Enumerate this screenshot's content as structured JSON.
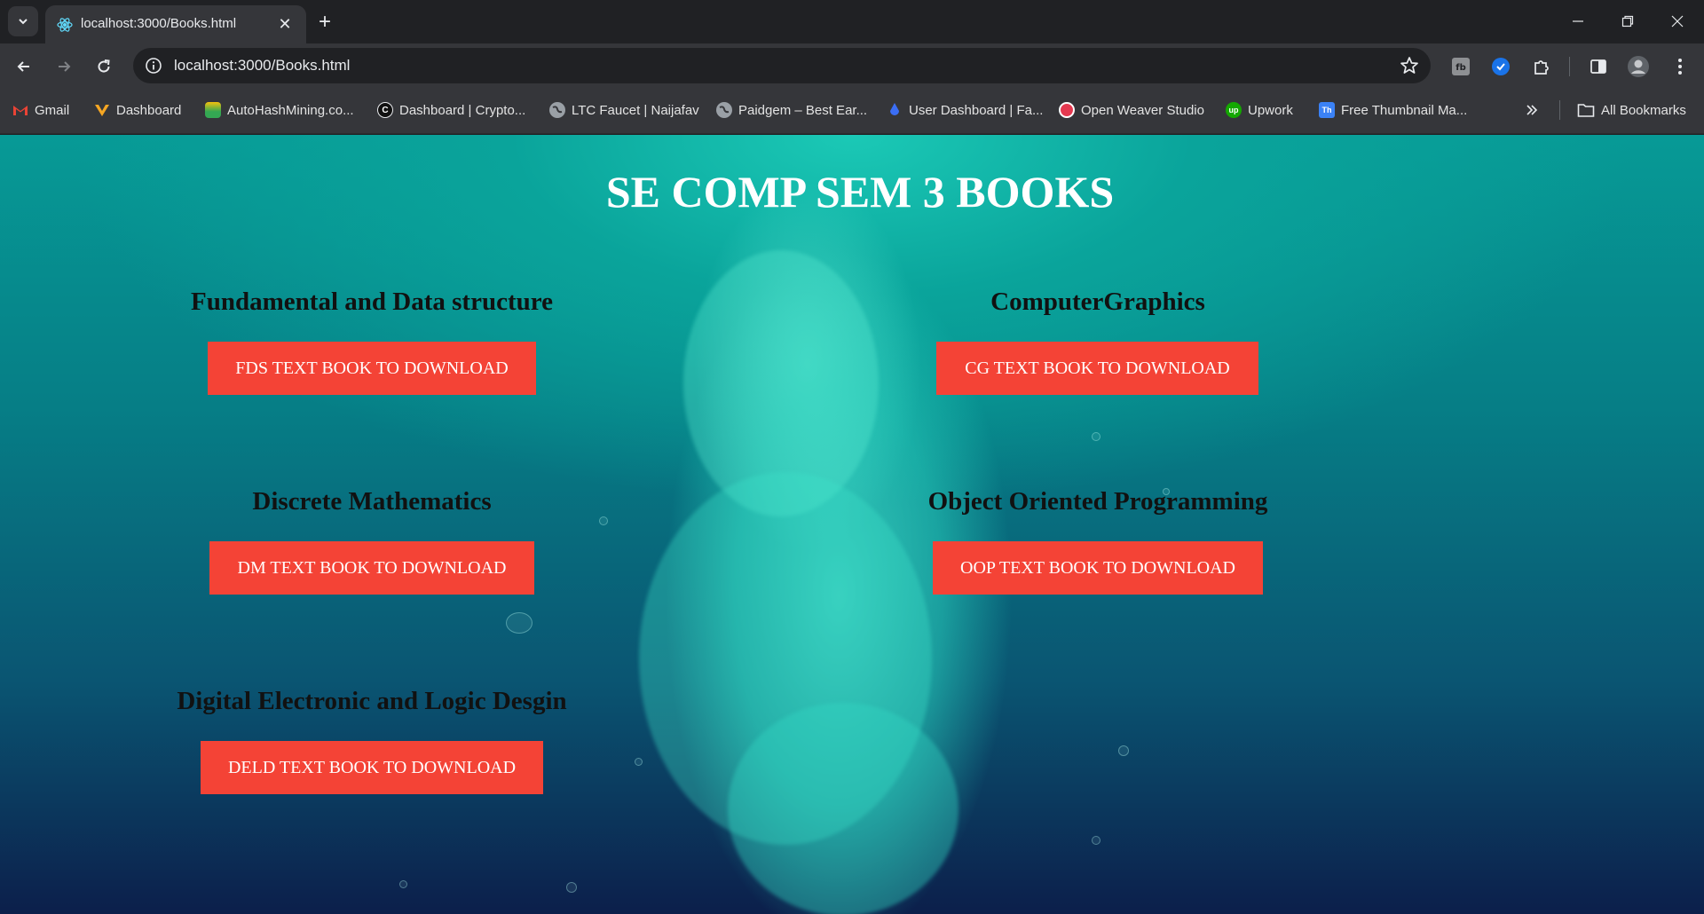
{
  "browser": {
    "tab": {
      "title": "localhost:3000/Books.html"
    },
    "url": "localhost:3000/Books.html",
    "bookmarks": [
      {
        "label": "Gmail",
        "icon": "gmail-icon",
        "color": "#ea4335"
      },
      {
        "label": "Dashboard",
        "icon": "dashboard-icon",
        "color": "#f5a623"
      },
      {
        "label": "AutoHashMining.co...",
        "icon": "autohashmining-icon",
        "color": "#34a853"
      },
      {
        "label": "Dashboard | Crypto...",
        "icon": "crypto-icon",
        "color": "#111111"
      },
      {
        "label": "LTC Faucet | Naijafav",
        "icon": "globe-icon",
        "color": "#9aa0a6"
      },
      {
        "label": "Paidgem – Best Ear...",
        "icon": "globe-icon",
        "color": "#9aa0a6"
      },
      {
        "label": "User Dashboard | Fa...",
        "icon": "drop-icon",
        "color": "#3b6ef5"
      },
      {
        "label": "Open Weaver Studio",
        "icon": "openweaver-icon",
        "color": "#e53950"
      },
      {
        "label": "Upwork",
        "icon": "upwork-icon",
        "color": "#14a800"
      },
      {
        "label": "Free Thumbnail Ma...",
        "icon": "thumbnail-icon",
        "color": "#3b82f6"
      }
    ],
    "all_bookmarks": "All Bookmarks"
  },
  "page": {
    "title": "SE COMP SEM 3 BOOKS",
    "books": [
      {
        "subject": "Fundamental and Data structure",
        "button": "FDS TEXT BOOK TO DOWNLOAD"
      },
      {
        "subject": "ComputerGraphics",
        "button": "CG TEXT BOOK TO DOWNLOAD"
      },
      {
        "subject": "Discrete Mathematics",
        "button": "DM TEXT BOOK TO DOWNLOAD"
      },
      {
        "subject": "Object Oriented Programming",
        "button": "OOP TEXT BOOK TO DOWNLOAD"
      },
      {
        "subject": "Digital Electronic and Logic Desgin",
        "button": "DELD TEXT BOOK TO DOWNLOAD"
      }
    ]
  },
  "colors": {
    "button_bg": "#f44336",
    "title_text": "#ffffff",
    "subject_text": "#111111"
  }
}
